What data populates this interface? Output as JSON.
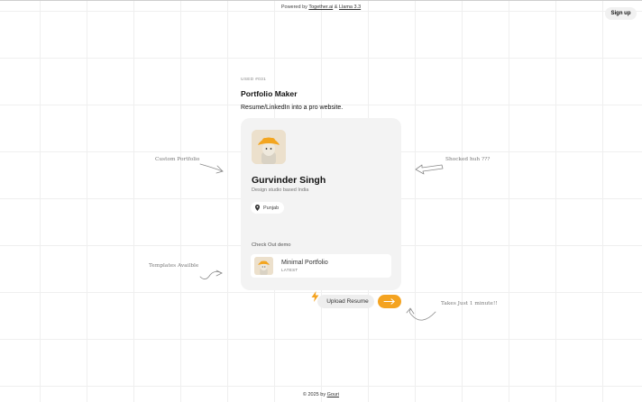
{
  "header": {
    "powered_prefix": "Powered by",
    "link_one": "Together.ai",
    "joiner": "&",
    "link_two": "Llama 3.3",
    "signup_label": "Sign up"
  },
  "intro": {
    "tag": "USED #031",
    "title": "Portfolio Maker",
    "subtitle": "Resume/LinkedIn into a pro website."
  },
  "profile": {
    "name": "Gurvinder Singh",
    "role": "Design studio based India",
    "location": "Punjab",
    "check_out_label": "Check Out demo",
    "demo_title": "Minimal Portfolio",
    "demo_tag": "LATEST"
  },
  "actions": {
    "upload_label": "Upload Resume"
  },
  "annotations": {
    "custom": "Custom Portfolio",
    "templates": "Templates Availble",
    "shocked": "Shocked huh ???",
    "takes": "Takes Just 1 minute!!"
  },
  "footer": {
    "prefix": "© 2025 by",
    "author": "Gouri"
  },
  "colors": {
    "accent": "#f4a320",
    "card": "#f3f3f3",
    "hat": "#f3a51f"
  },
  "icons": [
    "location-pin-icon",
    "lightning-bolt-icon",
    "arrow-right-icon",
    "hand-drawn-arrow-icon"
  ]
}
